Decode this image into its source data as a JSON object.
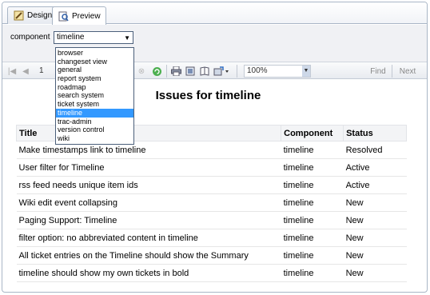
{
  "tabs": [
    {
      "label": "Design",
      "icon": "design-icon"
    },
    {
      "label": "Preview",
      "icon": "preview-icon"
    }
  ],
  "parameter": {
    "label": "component",
    "selected": "timeline",
    "options": [
      "browser",
      "changeset view",
      "general",
      "report system",
      "roadmap",
      "search system",
      "ticket system",
      "timeline",
      "trac-admin",
      "version control",
      "wiki"
    ]
  },
  "toolbar": {
    "page": "1",
    "zoom": "100%",
    "find_label": "Find",
    "next_label": "Next"
  },
  "report": {
    "title": "Issues for timeline",
    "columns": [
      "Title",
      "Component",
      "Status"
    ],
    "rows": [
      [
        "Make timestamps link to timeline",
        "timeline",
        "Resolved"
      ],
      [
        "User filter for Timeline",
        "timeline",
        "Active"
      ],
      [
        "rss feed needs unique item ids",
        "timeline",
        "Active"
      ],
      [
        "Wiki edit event collapsing",
        "timeline",
        "New"
      ],
      [
        "Paging Support: Timeline",
        "timeline",
        "New"
      ],
      [
        "filter option: no abbreviated content in timeline",
        "timeline",
        "New"
      ],
      [
        "All ticket entries on the Timeline should show the Summary",
        "timeline",
        "New"
      ],
      [
        "timeline should show my own tickets in bold",
        "timeline",
        "New"
      ]
    ]
  }
}
